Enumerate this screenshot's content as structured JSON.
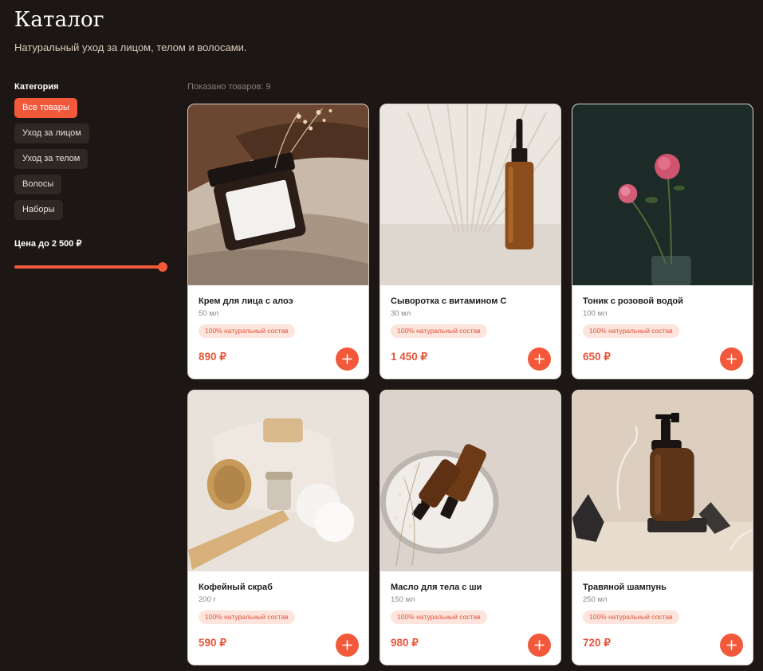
{
  "header": {
    "title": "Каталог",
    "subtitle": "Натуральный уход за лицом, телом и волосами."
  },
  "sidebar": {
    "category_title": "Категория",
    "categories": [
      {
        "label": "Все товары",
        "active": true
      },
      {
        "label": "Уход за лицом",
        "active": false
      },
      {
        "label": "Уход за телом",
        "active": false
      },
      {
        "label": "Волосы",
        "active": false
      },
      {
        "label": "Наборы",
        "active": false
      }
    ],
    "price_title": "Цена до 2 500 ₽",
    "price_slider_fraction": 1.0
  },
  "results": {
    "count_text": "Показано товаров: 9"
  },
  "products": [
    {
      "name": "Крем для лица с алоэ",
      "volume": "50 мл",
      "badge": "100% натуральный состав",
      "price": "890 ₽",
      "image_icon": "cream-jar-photo"
    },
    {
      "name": "Сыворотка с витамином С",
      "volume": "30 мл",
      "badge": "100% натуральный состав",
      "price": "1 450 ₽",
      "image_icon": "serum-dropper-photo"
    },
    {
      "name": "Тоник с розовой водой",
      "volume": "100 мл",
      "badge": "100% натуральный состав",
      "price": "650 ₽",
      "image_icon": "rose-vase-photo"
    },
    {
      "name": "Кофейный скраб",
      "volume": "200 г",
      "badge": "100% натуральный состав",
      "price": "590 ₽",
      "image_icon": "scrub-brush-photo"
    },
    {
      "name": "Масло для тела с ши",
      "volume": "150 мл",
      "badge": "100% натуральный состав",
      "price": "980 ₽",
      "image_icon": "oil-bottles-photo"
    },
    {
      "name": "Травяной шампунь",
      "volume": "250 мл",
      "badge": "100% натуральный состав",
      "price": "720 ₽",
      "image_icon": "shampoo-pump-photo"
    }
  ],
  "colors": {
    "accent": "#f2583a",
    "background": "#1c1614",
    "badge_bg": "#fde4dc"
  }
}
